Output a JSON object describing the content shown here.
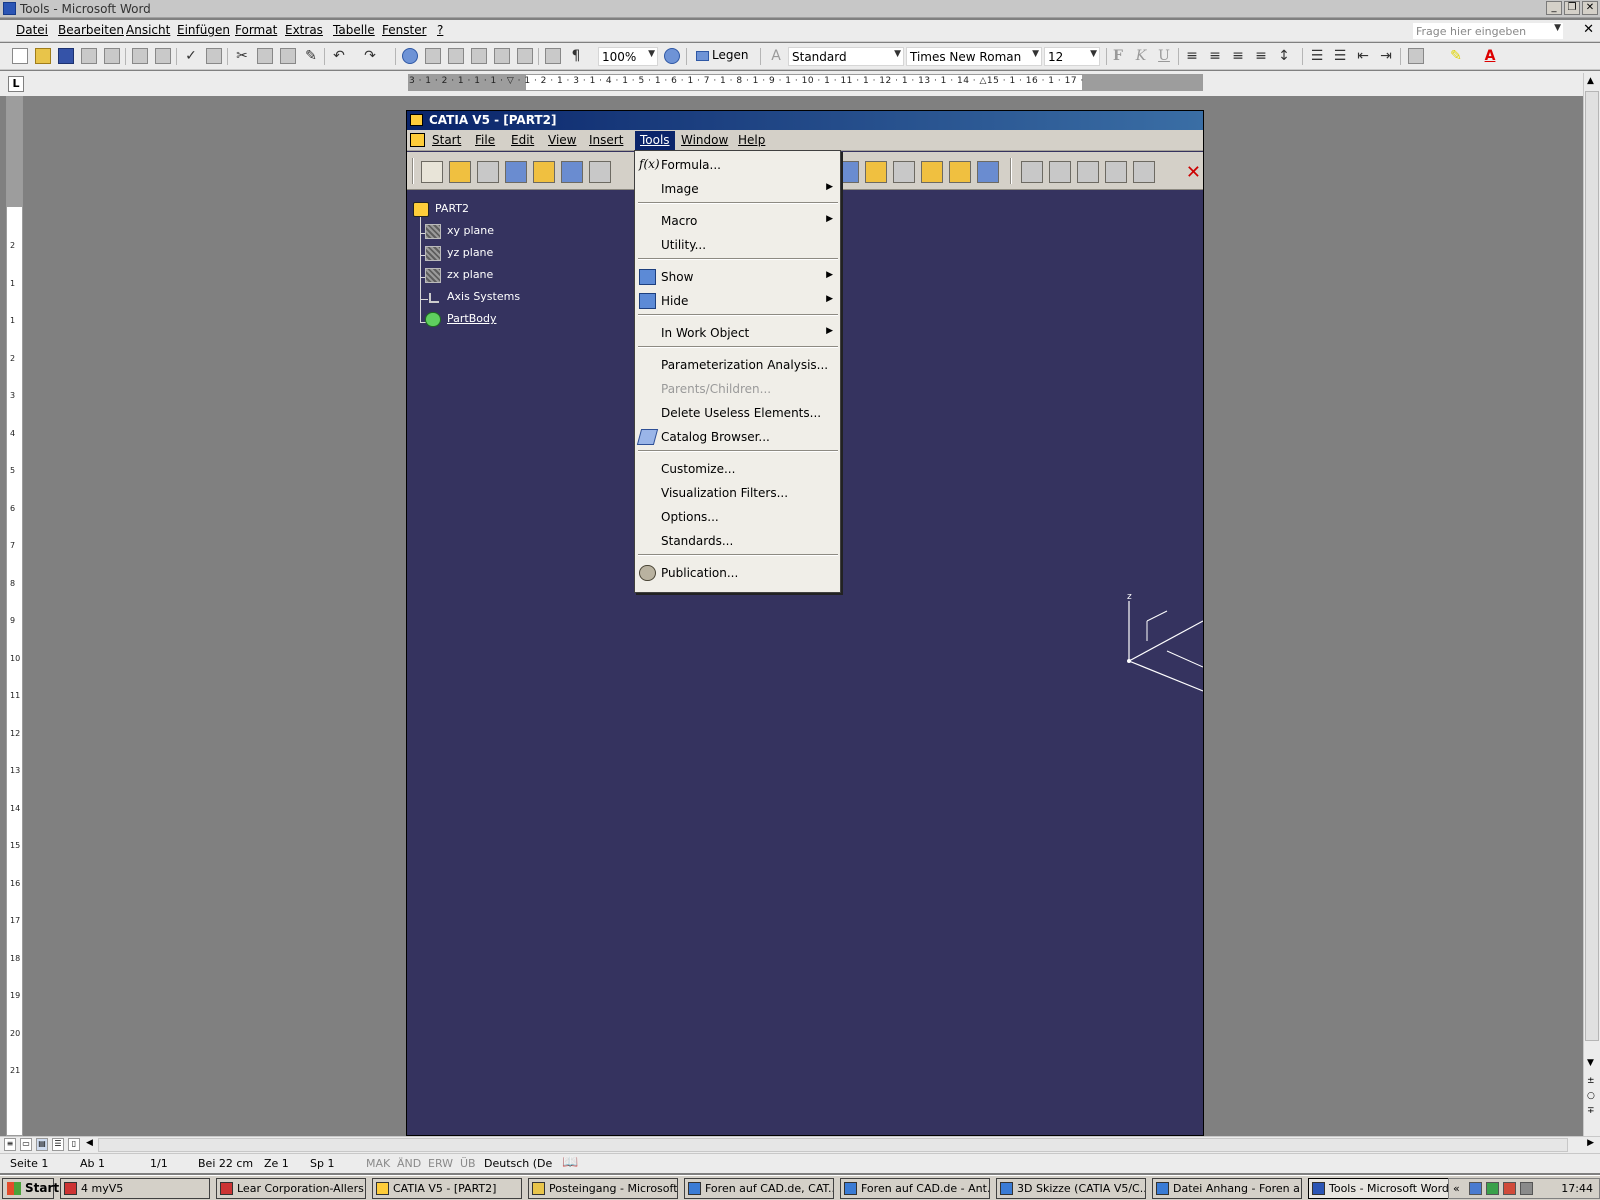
{
  "word": {
    "title": "Tools - Microsoft Word",
    "menu": [
      "Datei",
      "Bearbeiten",
      "Ansicht",
      "Einfügen",
      "Format",
      "Extras",
      "Tabelle",
      "Fenster",
      "?"
    ],
    "ask_placeholder": "Frage hier eingeben",
    "zoom": "100%",
    "read_label": "Legen",
    "style": "Standard",
    "font": "Times New Roman",
    "font_size": "12",
    "format_buttons": [
      "F",
      "K",
      "U"
    ],
    "ruler_h": "3 · 1 · 2 · 1 · 1 · 1 · ▽ · 1 · 2 · 1 · 3 · 1 · 4 · 1 · 5 · 1 · 6 · 1 · 7 · 1 · 8 · 1 · 9 · 1 · 10 · 1 · 11 · 1 · 12 · 1 · 13 · 1 · 14 · △15 · 1 · 16 · 1 · 17 ·",
    "ruler_v": [
      "2",
      "1",
      "",
      "1",
      "2",
      "3",
      "4",
      "5",
      "6",
      "7",
      "8",
      "9",
      "10",
      "11",
      "12",
      "13",
      "14",
      "15",
      "16",
      "17",
      "18",
      "19",
      "20",
      "21",
      "22",
      "23",
      "24"
    ],
    "status": {
      "page": "Seite 1",
      "section": "Ab 1",
      "pages": "1/1",
      "at": "Bei 22 cm",
      "line": "Ze 1",
      "col": "Sp 1",
      "rec": "MAK",
      "trk": "ÄND",
      "ext": "ERW",
      "ovr": "ÜB",
      "lang": "Deutsch (De"
    }
  },
  "catia": {
    "title": "CATIA V5 - [PART2]",
    "menu": [
      "Start",
      "File",
      "Edit",
      "View",
      "Insert",
      "Tools",
      "Window",
      "Help"
    ],
    "active_menu": "Tools",
    "tree": {
      "root": "PART2",
      "items": [
        "xy plane",
        "yz plane",
        "zx plane",
        "Axis Systems",
        "PartBody"
      ]
    },
    "axis_label": "z",
    "tools_menu": [
      {
        "label": "Formula...",
        "icon": "formula-icon",
        "submenu": false,
        "enabled": true
      },
      {
        "label": "Image",
        "icon": "",
        "submenu": true,
        "enabled": true
      },
      {
        "label": "Macro",
        "icon": "",
        "submenu": true,
        "enabled": true
      },
      {
        "label": "Utility...",
        "icon": "",
        "submenu": false,
        "enabled": true
      },
      {
        "label": "Show",
        "icon": "show-icon",
        "submenu": true,
        "enabled": true
      },
      {
        "label": "Hide",
        "icon": "hide-icon",
        "submenu": true,
        "enabled": true
      },
      {
        "label": "In Work Object",
        "icon": "",
        "submenu": true,
        "enabled": true
      },
      {
        "label": "Parameterization Analysis...",
        "icon": "",
        "submenu": false,
        "enabled": true
      },
      {
        "label": "Parents/Children...",
        "icon": "",
        "submenu": false,
        "enabled": false
      },
      {
        "label": "Delete Useless Elements...",
        "icon": "",
        "submenu": false,
        "enabled": true
      },
      {
        "label": "Catalog Browser...",
        "icon": "catalog-icon",
        "submenu": false,
        "enabled": true
      },
      {
        "label": "Customize...",
        "icon": "",
        "submenu": false,
        "enabled": true
      },
      {
        "label": "Visualization Filters...",
        "icon": "",
        "submenu": false,
        "enabled": true
      },
      {
        "label": "Options...",
        "icon": "",
        "submenu": false,
        "enabled": true
      },
      {
        "label": "Standards...",
        "icon": "",
        "submenu": false,
        "enabled": true
      },
      {
        "label": "Publication...",
        "icon": "publication-icon",
        "submenu": false,
        "enabled": true
      }
    ]
  },
  "taskbar": {
    "start_label": "Start",
    "tasks": [
      "4 myV5",
      "Lear Corporation-Allers...",
      "CATIA V5 - [PART2]",
      "Posteingang - Microsoft...",
      "Foren auf CAD.de, CAT...",
      "Foren auf CAD.de - Ant...",
      "3D Skizze (CATIA V5/C...",
      "Datei Anhang - Foren a...",
      "Tools - Microsoft Word"
    ],
    "active_task": "Tools - Microsoft Word",
    "clock": "17:44",
    "tray_chevron": "«"
  }
}
